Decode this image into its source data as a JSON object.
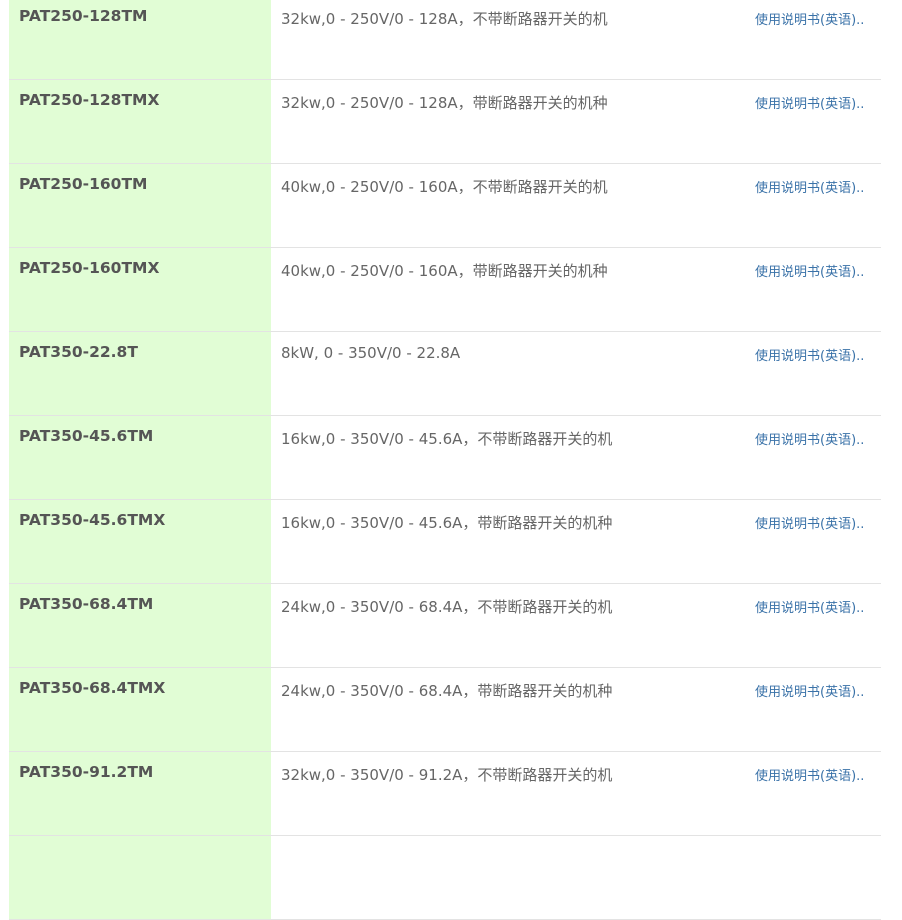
{
  "rows": [
    {
      "model": "PAT250-128TM",
      "desc": "32kw,0 - 250V/0 - 128A，不带断路器开关的机",
      "link": "使用说明书(英语).."
    },
    {
      "model": "PAT250-128TMX",
      "desc": "32kw,0 - 250V/0 - 128A，带断路器开关的机种",
      "link": "使用说明书(英语).."
    },
    {
      "model": "PAT250-160TM",
      "desc": "40kw,0 - 250V/0 - 160A，不带断路器开关的机",
      "link": "使用说明书(英语).."
    },
    {
      "model": "PAT250-160TMX",
      "desc": "40kw,0 - 250V/0 - 160A，带断路器开关的机种",
      "link": "使用说明书(英语).."
    },
    {
      "model": "PAT350-22.8T",
      "desc": "8kW, 0 - 350V/0 - 22.8A",
      "link": "使用说明书(英语).."
    },
    {
      "model": "PAT350-45.6TM",
      "desc": "16kw,0 - 350V/0 - 45.6A，不带断路器开关的机",
      "link": "使用说明书(英语).."
    },
    {
      "model": "PAT350-45.6TMX",
      "desc": "16kw,0 - 350V/0 - 45.6A，带断路器开关的机种",
      "link": "使用说明书(英语).."
    },
    {
      "model": "PAT350-68.4TM",
      "desc": "24kw,0 - 350V/0 - 68.4A，不带断路器开关的机",
      "link": "使用说明书(英语).."
    },
    {
      "model": "PAT350-68.4TMX",
      "desc": "24kw,0 - 350V/0 - 68.4A，带断路器开关的机种",
      "link": "使用说明书(英语).."
    },
    {
      "model": "PAT350-91.2TM",
      "desc": "32kw,0 - 350V/0 - 91.2A，不带断路器开关的机",
      "link": "使用说明书(英语).."
    },
    {
      "model": "",
      "desc": "",
      "link": ""
    }
  ],
  "colors": {
    "model_column_bg": "#e1fdd5",
    "link": "#3a72a8",
    "divider": "#e3e3e3"
  }
}
